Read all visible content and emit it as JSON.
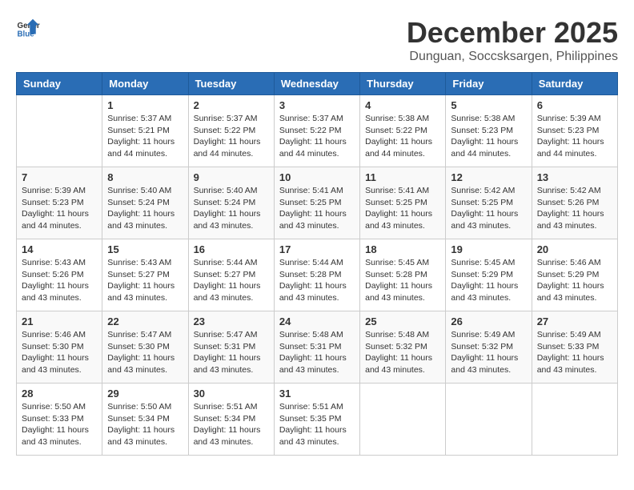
{
  "header": {
    "logo_line1": "General",
    "logo_line2": "Blue",
    "month": "December 2025",
    "location": "Dunguan, Soccsksargen, Philippines"
  },
  "days_of_week": [
    "Sunday",
    "Monday",
    "Tuesday",
    "Wednesday",
    "Thursday",
    "Friday",
    "Saturday"
  ],
  "weeks": [
    [
      {
        "day": "",
        "sunrise": "",
        "sunset": "",
        "daylight": ""
      },
      {
        "day": "1",
        "sunrise": "Sunrise: 5:37 AM",
        "sunset": "Sunset: 5:21 PM",
        "daylight": "Daylight: 11 hours and 44 minutes."
      },
      {
        "day": "2",
        "sunrise": "Sunrise: 5:37 AM",
        "sunset": "Sunset: 5:22 PM",
        "daylight": "Daylight: 11 hours and 44 minutes."
      },
      {
        "day": "3",
        "sunrise": "Sunrise: 5:37 AM",
        "sunset": "Sunset: 5:22 PM",
        "daylight": "Daylight: 11 hours and 44 minutes."
      },
      {
        "day": "4",
        "sunrise": "Sunrise: 5:38 AM",
        "sunset": "Sunset: 5:22 PM",
        "daylight": "Daylight: 11 hours and 44 minutes."
      },
      {
        "day": "5",
        "sunrise": "Sunrise: 5:38 AM",
        "sunset": "Sunset: 5:23 PM",
        "daylight": "Daylight: 11 hours and 44 minutes."
      },
      {
        "day": "6",
        "sunrise": "Sunrise: 5:39 AM",
        "sunset": "Sunset: 5:23 PM",
        "daylight": "Daylight: 11 hours and 44 minutes."
      }
    ],
    [
      {
        "day": "7",
        "sunrise": "Sunrise: 5:39 AM",
        "sunset": "Sunset: 5:23 PM",
        "daylight": "Daylight: 11 hours and 44 minutes."
      },
      {
        "day": "8",
        "sunrise": "Sunrise: 5:40 AM",
        "sunset": "Sunset: 5:24 PM",
        "daylight": "Daylight: 11 hours and 43 minutes."
      },
      {
        "day": "9",
        "sunrise": "Sunrise: 5:40 AM",
        "sunset": "Sunset: 5:24 PM",
        "daylight": "Daylight: 11 hours and 43 minutes."
      },
      {
        "day": "10",
        "sunrise": "Sunrise: 5:41 AM",
        "sunset": "Sunset: 5:25 PM",
        "daylight": "Daylight: 11 hours and 43 minutes."
      },
      {
        "day": "11",
        "sunrise": "Sunrise: 5:41 AM",
        "sunset": "Sunset: 5:25 PM",
        "daylight": "Daylight: 11 hours and 43 minutes."
      },
      {
        "day": "12",
        "sunrise": "Sunrise: 5:42 AM",
        "sunset": "Sunset: 5:25 PM",
        "daylight": "Daylight: 11 hours and 43 minutes."
      },
      {
        "day": "13",
        "sunrise": "Sunrise: 5:42 AM",
        "sunset": "Sunset: 5:26 PM",
        "daylight": "Daylight: 11 hours and 43 minutes."
      }
    ],
    [
      {
        "day": "14",
        "sunrise": "Sunrise: 5:43 AM",
        "sunset": "Sunset: 5:26 PM",
        "daylight": "Daylight: 11 hours and 43 minutes."
      },
      {
        "day": "15",
        "sunrise": "Sunrise: 5:43 AM",
        "sunset": "Sunset: 5:27 PM",
        "daylight": "Daylight: 11 hours and 43 minutes."
      },
      {
        "day": "16",
        "sunrise": "Sunrise: 5:44 AM",
        "sunset": "Sunset: 5:27 PM",
        "daylight": "Daylight: 11 hours and 43 minutes."
      },
      {
        "day": "17",
        "sunrise": "Sunrise: 5:44 AM",
        "sunset": "Sunset: 5:28 PM",
        "daylight": "Daylight: 11 hours and 43 minutes."
      },
      {
        "day": "18",
        "sunrise": "Sunrise: 5:45 AM",
        "sunset": "Sunset: 5:28 PM",
        "daylight": "Daylight: 11 hours and 43 minutes."
      },
      {
        "day": "19",
        "sunrise": "Sunrise: 5:45 AM",
        "sunset": "Sunset: 5:29 PM",
        "daylight": "Daylight: 11 hours and 43 minutes."
      },
      {
        "day": "20",
        "sunrise": "Sunrise: 5:46 AM",
        "sunset": "Sunset: 5:29 PM",
        "daylight": "Daylight: 11 hours and 43 minutes."
      }
    ],
    [
      {
        "day": "21",
        "sunrise": "Sunrise: 5:46 AM",
        "sunset": "Sunset: 5:30 PM",
        "daylight": "Daylight: 11 hours and 43 minutes."
      },
      {
        "day": "22",
        "sunrise": "Sunrise: 5:47 AM",
        "sunset": "Sunset: 5:30 PM",
        "daylight": "Daylight: 11 hours and 43 minutes."
      },
      {
        "day": "23",
        "sunrise": "Sunrise: 5:47 AM",
        "sunset": "Sunset: 5:31 PM",
        "daylight": "Daylight: 11 hours and 43 minutes."
      },
      {
        "day": "24",
        "sunrise": "Sunrise: 5:48 AM",
        "sunset": "Sunset: 5:31 PM",
        "daylight": "Daylight: 11 hours and 43 minutes."
      },
      {
        "day": "25",
        "sunrise": "Sunrise: 5:48 AM",
        "sunset": "Sunset: 5:32 PM",
        "daylight": "Daylight: 11 hours and 43 minutes."
      },
      {
        "day": "26",
        "sunrise": "Sunrise: 5:49 AM",
        "sunset": "Sunset: 5:32 PM",
        "daylight": "Daylight: 11 hours and 43 minutes."
      },
      {
        "day": "27",
        "sunrise": "Sunrise: 5:49 AM",
        "sunset": "Sunset: 5:33 PM",
        "daylight": "Daylight: 11 hours and 43 minutes."
      }
    ],
    [
      {
        "day": "28",
        "sunrise": "Sunrise: 5:50 AM",
        "sunset": "Sunset: 5:33 PM",
        "daylight": "Daylight: 11 hours and 43 minutes."
      },
      {
        "day": "29",
        "sunrise": "Sunrise: 5:50 AM",
        "sunset": "Sunset: 5:34 PM",
        "daylight": "Daylight: 11 hours and 43 minutes."
      },
      {
        "day": "30",
        "sunrise": "Sunrise: 5:51 AM",
        "sunset": "Sunset: 5:34 PM",
        "daylight": "Daylight: 11 hours and 43 minutes."
      },
      {
        "day": "31",
        "sunrise": "Sunrise: 5:51 AM",
        "sunset": "Sunset: 5:35 PM",
        "daylight": "Daylight: 11 hours and 43 minutes."
      },
      {
        "day": "",
        "sunrise": "",
        "sunset": "",
        "daylight": ""
      },
      {
        "day": "",
        "sunrise": "",
        "sunset": "",
        "daylight": ""
      },
      {
        "day": "",
        "sunrise": "",
        "sunset": "",
        "daylight": ""
      }
    ]
  ]
}
